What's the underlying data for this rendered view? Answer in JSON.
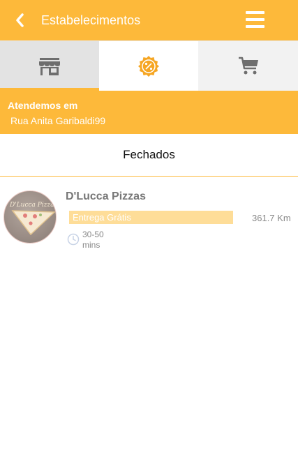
{
  "header": {
    "title": "Estabelecimentos",
    "back_icon": "chevron-left-icon",
    "menu_icon": "hamburger-menu-icon"
  },
  "tabs": [
    {
      "name": "stores",
      "icon": "storefront-icon",
      "selected": true
    },
    {
      "name": "promotions",
      "icon": "percent-badge-icon",
      "selected": false
    },
    {
      "name": "cart",
      "icon": "shopping-cart-icon",
      "selected": false
    }
  ],
  "service_area": {
    "label": "Atendemos em",
    "address": "Rua Anita Garibaldi99"
  },
  "section": {
    "title": "Fechados"
  },
  "stores": [
    {
      "name": "D'Lucca Pizzas",
      "logo_text": "D'Lucca Pizzas",
      "delivery": "Entrega Grátis",
      "distance": "361.7 Km",
      "time_range": "30-50",
      "time_unit": "mins"
    }
  ],
  "colors": {
    "primary": "#FDB93A",
    "tab_selected_bg": "#E3E3E3",
    "tab_bg": "#F2F2F2",
    "text_muted": "#888888",
    "delivery_badge": "#FEDD98"
  }
}
